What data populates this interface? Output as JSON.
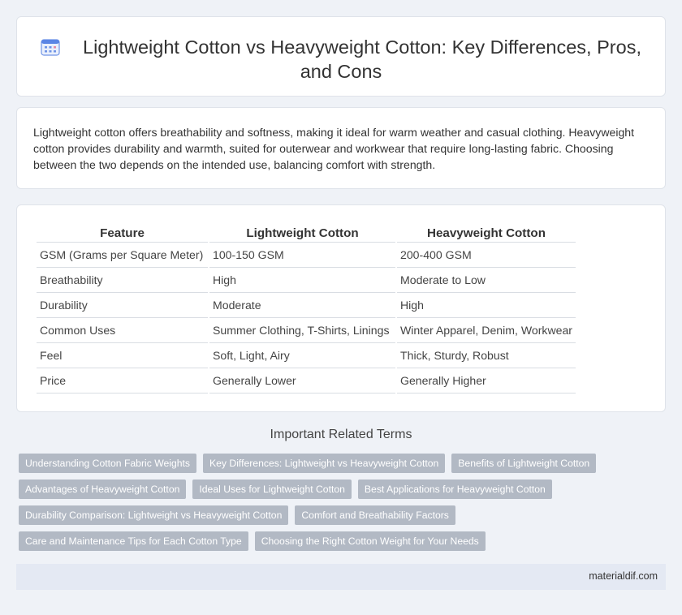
{
  "header": {
    "title": "Lightweight Cotton vs Heavyweight Cotton: Key Differences, Pros, and Cons",
    "icon": "calendar-icon",
    "icon_color": "#4a7ee8"
  },
  "intro": {
    "text": "Lightweight cotton offers breathability and softness, making it ideal for warm weather and casual clothing. Heavyweight cotton provides durability and warmth, suited for outerwear and workwear that require long-lasting fabric. Choosing between the two depends on the intended use, balancing comfort with strength."
  },
  "table": {
    "headers": [
      "Feature",
      "Lightweight Cotton",
      "Heavyweight Cotton"
    ],
    "rows": [
      [
        "GSM (Grams per Square Meter)",
        "100-150 GSM",
        "200-400 GSM"
      ],
      [
        "Breathability",
        "High",
        "Moderate to Low"
      ],
      [
        "Durability",
        "Moderate",
        "High"
      ],
      [
        "Common Uses",
        "Summer Clothing, T-Shirts, Linings",
        "Winter Apparel, Denim, Workwear"
      ],
      [
        "Feel",
        "Soft, Light, Airy",
        "Thick, Sturdy, Robust"
      ],
      [
        "Price",
        "Generally Lower",
        "Generally Higher"
      ]
    ]
  },
  "related": {
    "title": "Important Related Terms",
    "rows": [
      [
        "Understanding Cotton Fabric Weights",
        "Key Differences: Lightweight vs Heavyweight Cotton",
        "Benefits of Lightweight Cotton"
      ],
      [
        "Advantages of Heavyweight Cotton",
        "Ideal Uses for Lightweight Cotton",
        "Best Applications for Heavyweight Cotton"
      ],
      [
        "Durability Comparison: Lightweight vs Heavyweight Cotton",
        "Comfort and Breathability Factors"
      ],
      [
        "Care and Maintenance Tips for Each Cotton Type",
        "Choosing the Right Cotton Weight for Your Needs"
      ]
    ]
  },
  "footer": {
    "site": "materialdif.com"
  },
  "colors": {
    "background": "#eff2f7",
    "tag": "#b2b9c4",
    "footer": "#e4e9f3"
  }
}
